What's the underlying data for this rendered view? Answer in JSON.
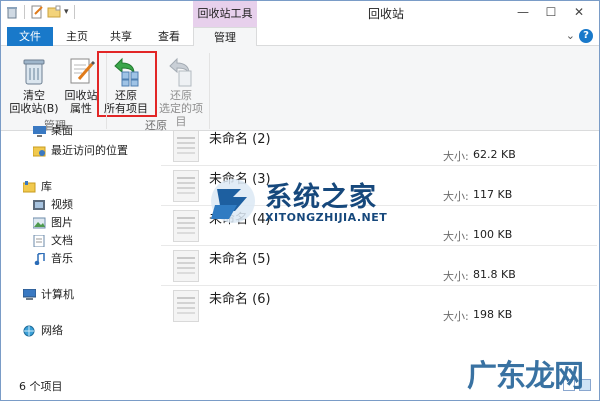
{
  "window": {
    "title": "回收站",
    "context_tab_group": "回收站工具"
  },
  "tabs": [
    {
      "label": "文件"
    },
    {
      "label": "主页"
    },
    {
      "label": "共享"
    },
    {
      "label": "查看"
    },
    {
      "label": "管理"
    }
  ],
  "ribbon": {
    "empty_bin": "清空\n回收站(B)",
    "empty_bin_l1": "清空",
    "empty_bin_l2": "回收站(B)",
    "properties_l1": "回收站",
    "properties_l2": "属性",
    "restore_all_l1": "还原",
    "restore_all_l2": "所有项目",
    "restore_sel_l1": "还原",
    "restore_sel_l2": "选定的项目",
    "group_manage": "管理",
    "group_restore": "还原"
  },
  "nav": {
    "items": [
      {
        "label": "桌面"
      },
      {
        "label": "最近访问的位置"
      },
      {
        "label": "库"
      },
      {
        "label": "视频"
      },
      {
        "label": "图片"
      },
      {
        "label": "文档"
      },
      {
        "label": "音乐"
      },
      {
        "label": "计算机"
      },
      {
        "label": "网络"
      }
    ]
  },
  "files": {
    "size_label": "大小:",
    "rows": [
      {
        "name": "未命名 (2)",
        "size": "62.2 KB"
      },
      {
        "name": "未命名 (3)",
        "size": "117 KB"
      },
      {
        "name": "未命名 (4)",
        "size": "100 KB"
      },
      {
        "name": "未命名 (5)",
        "size": "81.8 KB"
      },
      {
        "name": "未命名 (6)",
        "size": "198 KB"
      }
    ]
  },
  "status": {
    "count": "6 个项目"
  },
  "watermark": {
    "cn": "系统之家",
    "en": "XITONGZHIJIA.NET",
    "corner": "广东龙网"
  },
  "colors": {
    "accent": "#1979ca",
    "context_tab": "#e7d0ec",
    "highlight": "#e22626"
  }
}
